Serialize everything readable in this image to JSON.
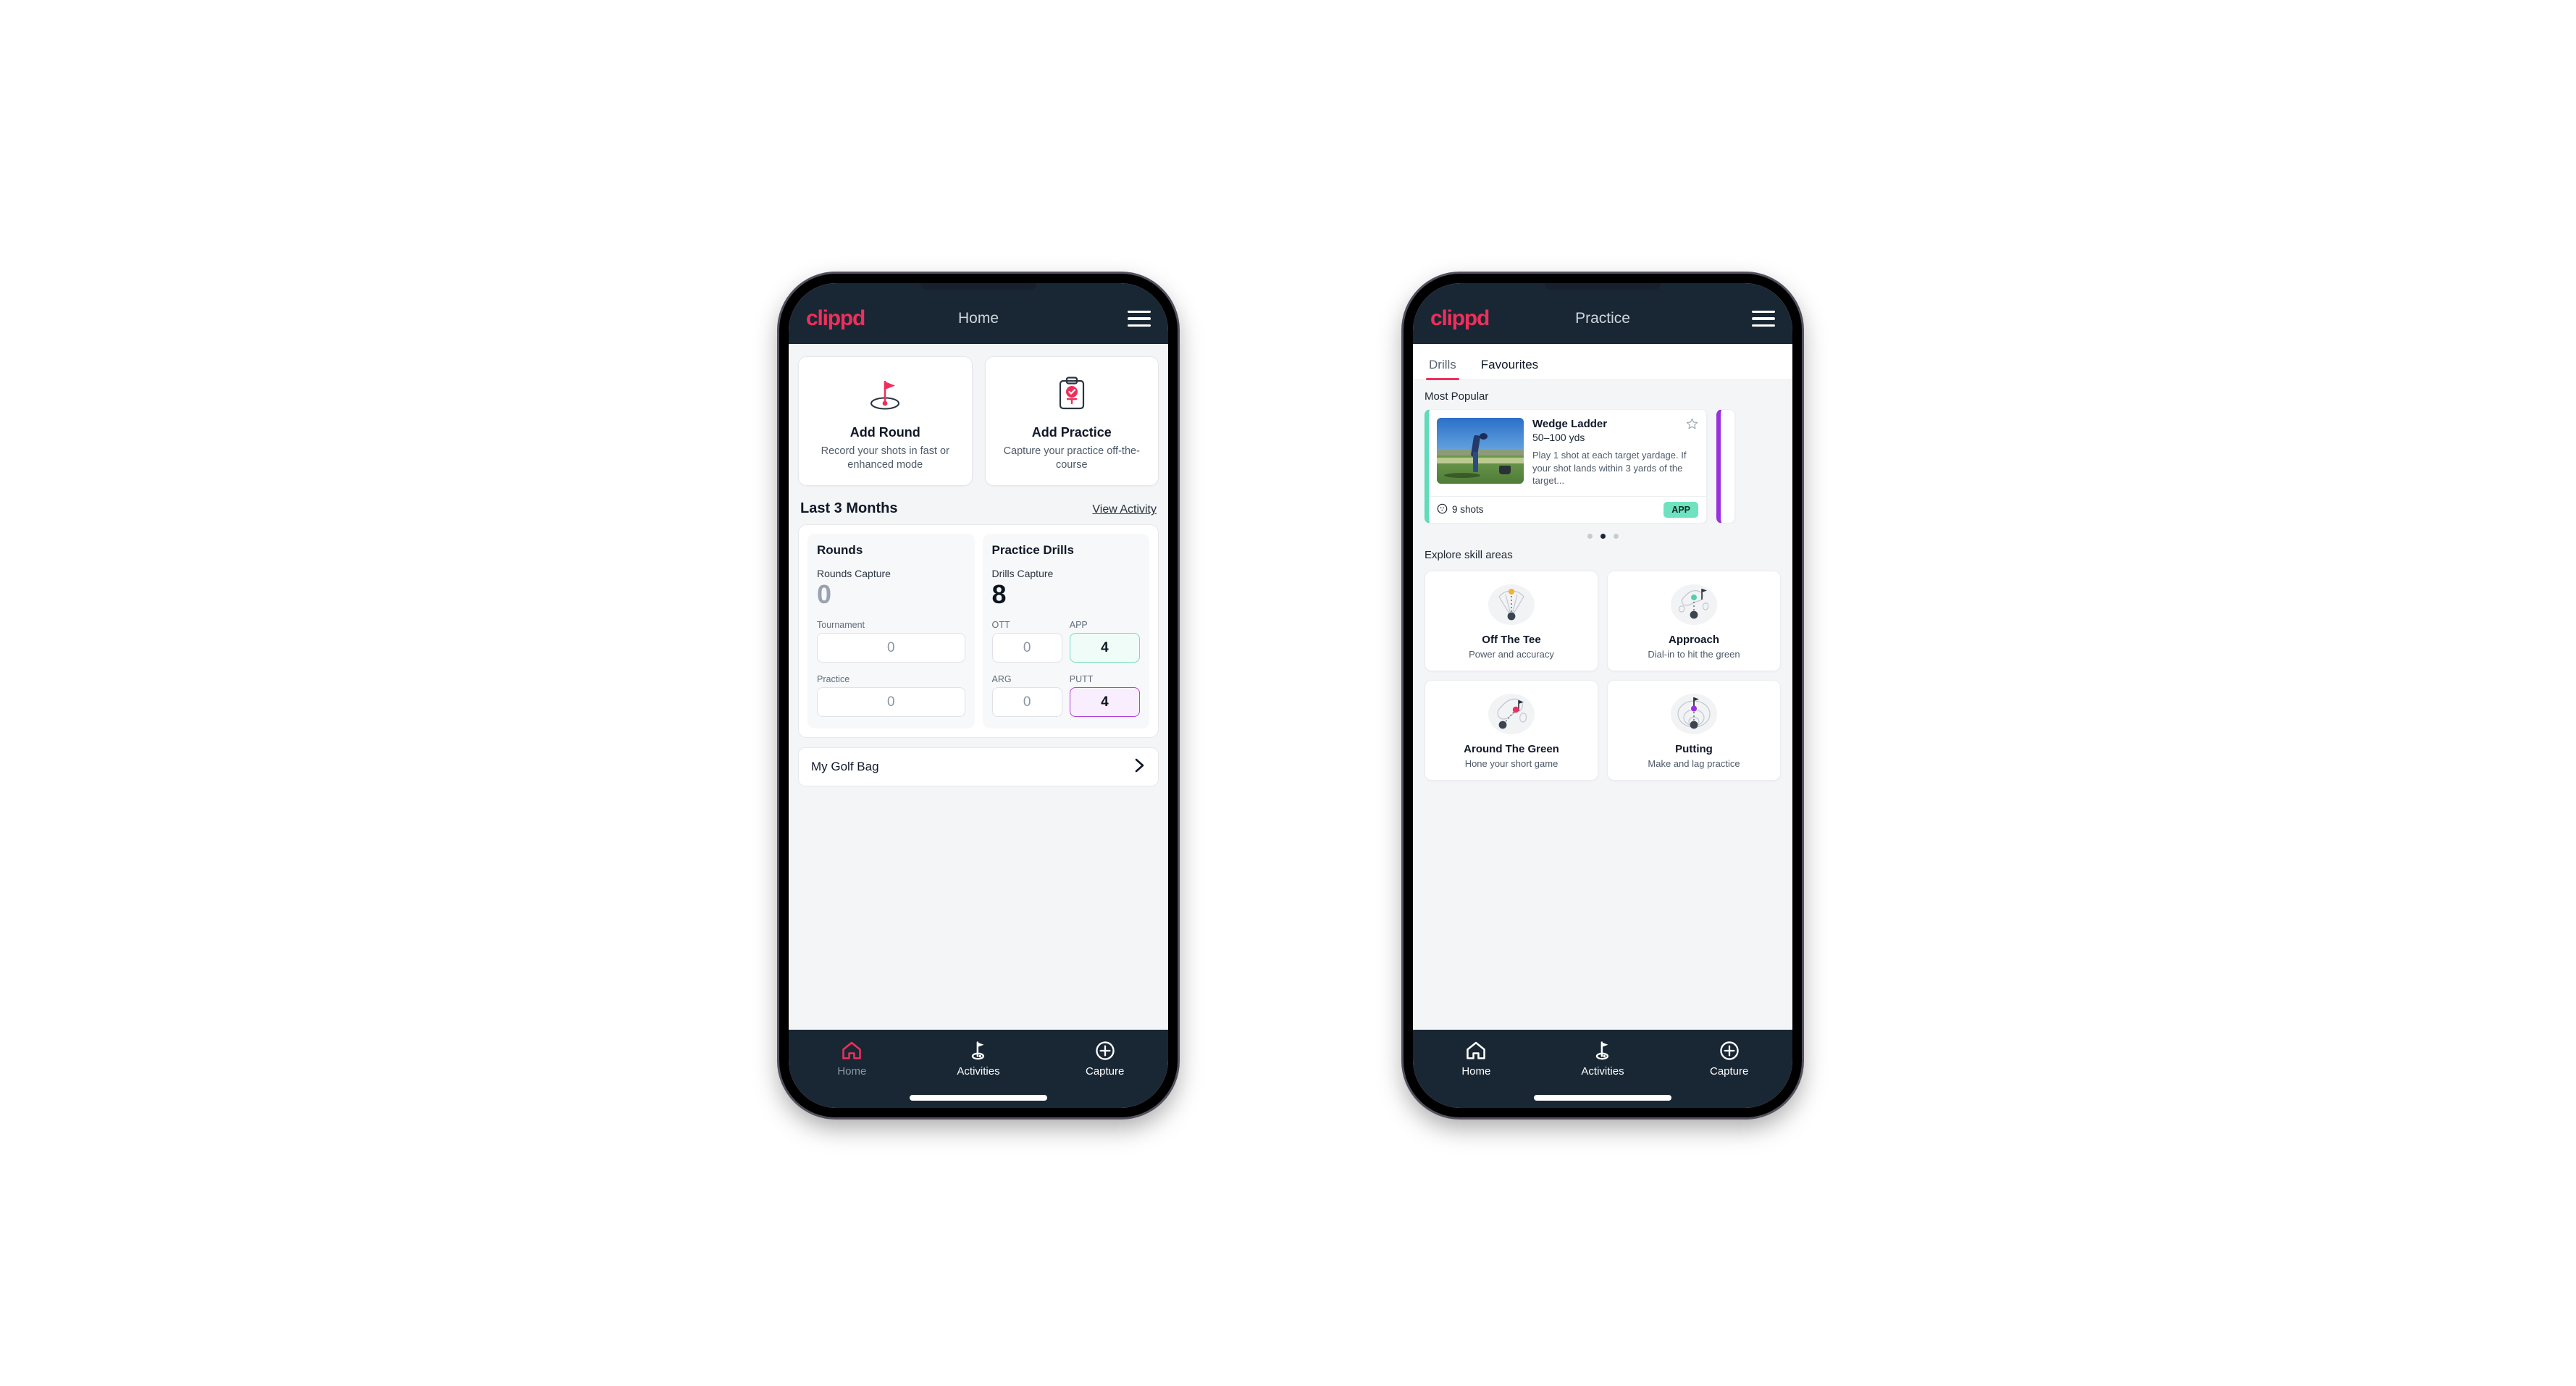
{
  "colors": {
    "brand_pink": "#ef2f5b",
    "header_dark": "#192734",
    "teal": "#6fe3c0",
    "purple": "#9b2fe0",
    "page_bg": "#f4f5f7"
  },
  "home_phone": {
    "brand": "clippd",
    "title": "Home",
    "menu_icon": "hamburger-icon",
    "action_cards": [
      {
        "icon": "golf-flag-hole-icon",
        "title": "Add Round",
        "subtitle": "Record your shots in fast or enhanced mode"
      },
      {
        "icon": "clipboard-check-icon",
        "title": "Add Practice",
        "subtitle": "Capture your practice off-the-course"
      }
    ],
    "section": {
      "heading": "Last 3 Months",
      "action_link": "View Activity"
    },
    "stats": {
      "rounds": {
        "title": "Rounds",
        "capture_label": "Rounds Capture",
        "capture_value": "0",
        "fields": [
          {
            "label": "Tournament",
            "value": "0",
            "style": "plain"
          },
          {
            "label": "Practice",
            "value": "0",
            "style": "plain"
          }
        ]
      },
      "practice_drills": {
        "title": "Practice Drills",
        "capture_label": "Drills Capture",
        "capture_value": "8",
        "fields": [
          {
            "label": "OTT",
            "value": "0",
            "style": "plain"
          },
          {
            "label": "APP",
            "value": "4",
            "style": "teal"
          },
          {
            "label": "ARG",
            "value": "0",
            "style": "plain"
          },
          {
            "label": "PUTT",
            "value": "4",
            "style": "purple"
          }
        ]
      }
    },
    "golf_bag": {
      "label": "My Golf Bag",
      "chevron_icon": "chevron-right-icon"
    },
    "bottom_nav": [
      {
        "icon": "home-icon",
        "label": "Home",
        "active_icon": true,
        "dim_label": true
      },
      {
        "icon": "golf-flag-icon",
        "label": "Activities",
        "active_icon": false,
        "dim_label": false
      },
      {
        "icon": "plus-circle-icon",
        "label": "Capture",
        "active_icon": false,
        "dim_label": false
      }
    ]
  },
  "practice_phone": {
    "brand": "clippd",
    "title": "Practice",
    "menu_icon": "hamburger-icon",
    "tabs": [
      {
        "label": "Drills",
        "active": true
      },
      {
        "label": "Favourites",
        "active": false
      }
    ],
    "most_popular": {
      "heading": "Most Popular",
      "drill": {
        "title": "Wedge Ladder",
        "yardage": "50–100 yds",
        "description": "Play 1 shot at each target yardage. If your shot lands within 3 yards of the target...",
        "shots": "9 shots",
        "shots_icon": "golf-ball-icon",
        "badge": "APP",
        "favourite_icon": "star-outline-icon",
        "thumbnail": "golfer-wedge-practice-photo"
      },
      "dots": [
        {
          "active": false
        },
        {
          "active": true
        },
        {
          "active": false
        }
      ]
    },
    "explore": {
      "heading": "Explore skill areas",
      "cards": [
        {
          "icon": "tee-shot-fan-icon",
          "title": "Off The Tee",
          "subtitle": "Power and accuracy"
        },
        {
          "icon": "approach-green-icon",
          "title": "Approach",
          "subtitle": "Dial-in to hit the green"
        },
        {
          "icon": "around-the-green-icon",
          "title": "Around The Green",
          "subtitle": "Hone your short game"
        },
        {
          "icon": "putting-rings-icon",
          "title": "Putting",
          "subtitle": "Make and lag practice"
        }
      ]
    },
    "bottom_nav": [
      {
        "icon": "home-icon",
        "label": "Home",
        "active_icon": false,
        "dim_label": false
      },
      {
        "icon": "golf-flag-icon",
        "label": "Activities",
        "active_icon": false,
        "dim_label": false
      },
      {
        "icon": "plus-circle-icon",
        "label": "Capture",
        "active_icon": false,
        "dim_label": false
      }
    ]
  }
}
